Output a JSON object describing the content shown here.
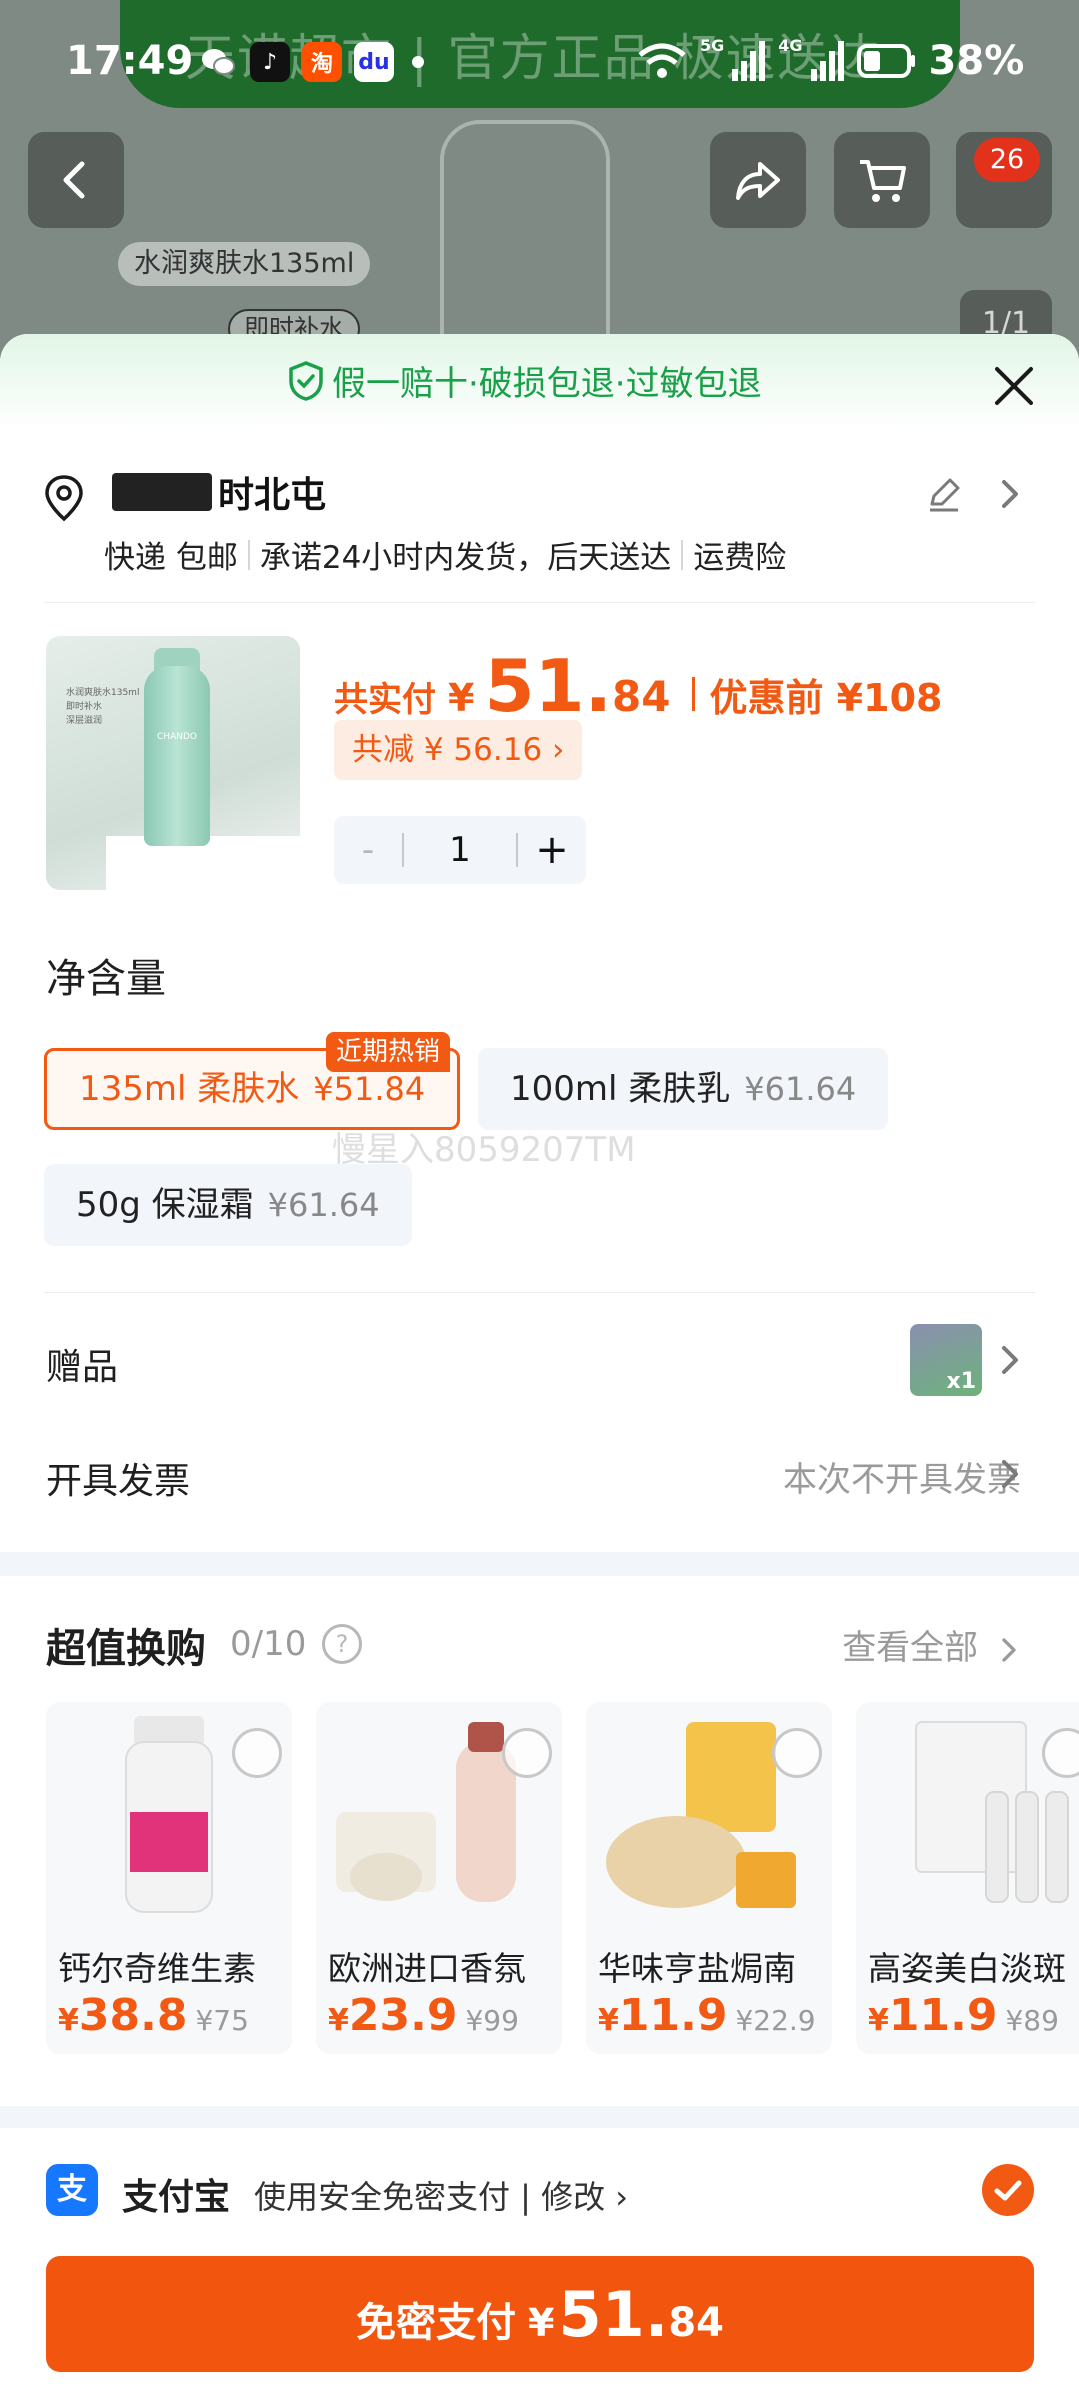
{
  "status_bar": {
    "time": "17:49",
    "battery": "38%",
    "network_1": "5G",
    "network_2": "4G",
    "app_icons": [
      "wechat-icon",
      "tiktok-icon",
      "taobao-icon",
      "baidu-icon"
    ]
  },
  "background_page": {
    "banner_text": "天诺超市 | 官方正品 极速送达",
    "product_label": "水润爽肤水135ml",
    "product_tag": "即时补水",
    "cart_badge": "26",
    "page_indicator": "1/1"
  },
  "sheet": {
    "guarantee": "假一赔十·破损包退·过敏包退",
    "address": {
      "name": "时北屯"
    },
    "delivery": {
      "method": "快递 包邮",
      "promise": "承诺24小时内发货，后天送达",
      "insurance": "运费险"
    },
    "product": {
      "image_text": {
        "brand": "CHANDO",
        "note1": "水润爽肤水135ml",
        "note2": "即时补水",
        "note3": "深层滋润"
      },
      "pay_label": "共实付",
      "currency": "¥",
      "price_int": "51.",
      "price_dec": "84",
      "original_price": "优惠前 ¥108",
      "discount": "共减 ¥ 56.16 ›",
      "quantity": "1",
      "minus": "-",
      "plus": "+"
    },
    "net_content": {
      "title": "净含量",
      "hot_badge": "近期热销",
      "options": [
        {
          "name": "135ml 柔肤水",
          "price": "¥51.84"
        },
        {
          "name": "100ml 柔肤乳",
          "price": "¥61.64"
        },
        {
          "name": "50g 保湿霜",
          "price": "¥61.64"
        }
      ]
    },
    "watermark": "慢星入8059207TM",
    "gift": {
      "label": "赠品",
      "count": "x1"
    },
    "invoice": {
      "label": "开具发票",
      "value": "本次不开具发票"
    },
    "swap": {
      "title": "超值换购",
      "count": "0/10",
      "help": "?",
      "see_all": "查看全部",
      "items": [
        {
          "name": "钙尔奇维生素",
          "currency": "¥",
          "price": "38.8",
          "old": "¥75"
        },
        {
          "name": "欧洲进口香氛",
          "currency": "¥",
          "price": "23.9",
          "old": "¥99"
        },
        {
          "name": "华味亨盐焗南",
          "currency": "¥",
          "price": "11.9",
          "old": "¥22.9"
        },
        {
          "name": "高姿美白淡斑",
          "currency": "¥",
          "price": "11.9",
          "old": "¥89"
        }
      ]
    },
    "payment": {
      "logo": "支",
      "method": "支付宝",
      "desc": "使用安全免密支付 | 修改 ›",
      "button_label": "免密支付",
      "button_currency": "¥",
      "button_int": "51.",
      "button_dec": "84"
    }
  },
  "colors": {
    "accent": "#f25a14",
    "guarantee_green": "#19a048",
    "alipay_blue": "#1677ff"
  }
}
